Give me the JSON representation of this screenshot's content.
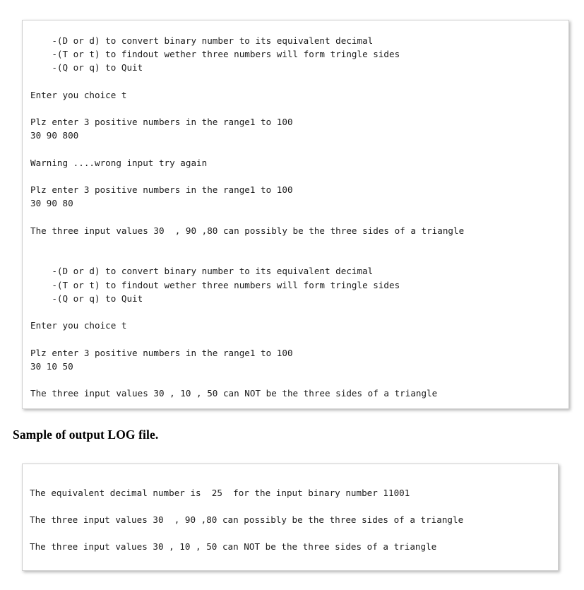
{
  "document": {
    "caption": "Sample of output LOG file."
  },
  "console_panel": {
    "title": "program console output",
    "lines": [
      "    -(D or d) to convert binary number to its equivalent decimal",
      "    -(T or t) to findout wether three numbers will form tringle sides",
      "    -(Q or q) to Quit",
      "",
      "Enter you choice t",
      "",
      "Plz enter 3 positive numbers in the range1 to 100",
      "30 90 800",
      "",
      "Warning ....wrong input try again",
      "",
      "Plz enter 3 positive numbers in the range1 to 100",
      "30 90 80",
      "",
      "The three input values 30  , 90 ,80 can possibly be the three sides of a triangle",
      "",
      "",
      "    -(D or d) to convert binary number to its equivalent decimal",
      "    -(T or t) to findout wether three numbers will form tringle sides",
      "    -(Q or q) to Quit",
      "",
      "Enter you choice t",
      "",
      "Plz enter 3 positive numbers in the range1 to 100",
      "30 10 50",
      "",
      "The three input values 30 , 10 , 50 can NOT be the three sides of a triangle"
    ]
  },
  "log_panel": {
    "title": "output LOG file contents",
    "lines": [
      "The equivalent decimal number is  25  for the input binary number 11001",
      "The three input values 30  , 90 ,80 can possibly be the three sides of a triangle",
      "The three input values 30 , 10 , 50 can NOT be the three sides of a triangle"
    ]
  }
}
